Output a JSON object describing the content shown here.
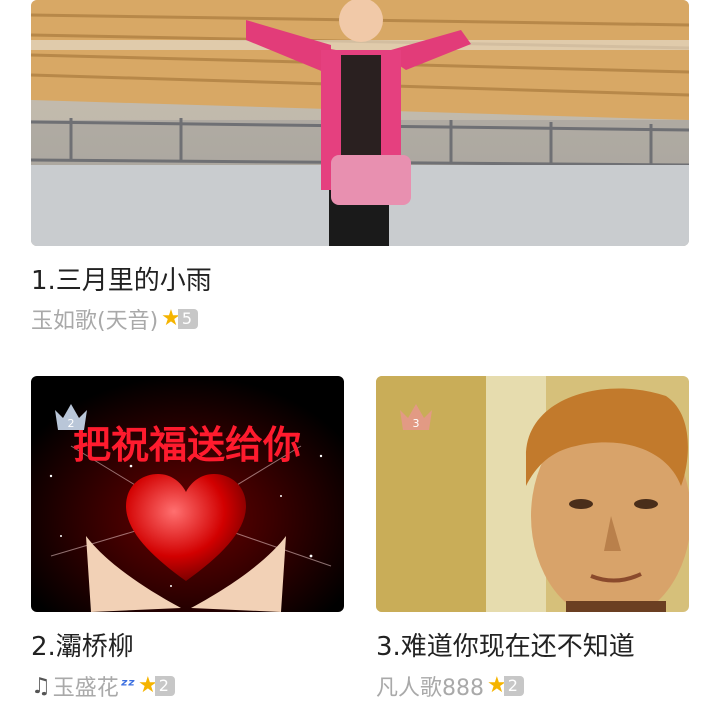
{
  "items": [
    {
      "rank_title": "1.三月里的小雨",
      "singer": "玉如歌(天音)",
      "level": "5"
    },
    {
      "rank_title": "2.灞桥柳",
      "singer": "玉盛花",
      "level": "2",
      "crown_rank": "2",
      "poster_text": "把祝福送给你"
    },
    {
      "rank_title": "3.难道你现在还不知道",
      "singer": "凡人歌888",
      "level": "2",
      "crown_rank": "3"
    }
  ],
  "colors": {
    "crown_silver": "#b9c6d8",
    "crown_bronze": "#e29a84",
    "star": "#f5b400",
    "badge": "#c7c7c7"
  },
  "icons": {
    "level": "star-icon",
    "rank": "crown-icon",
    "music": "music-note-icon",
    "sleep": "zzz-icon"
  }
}
